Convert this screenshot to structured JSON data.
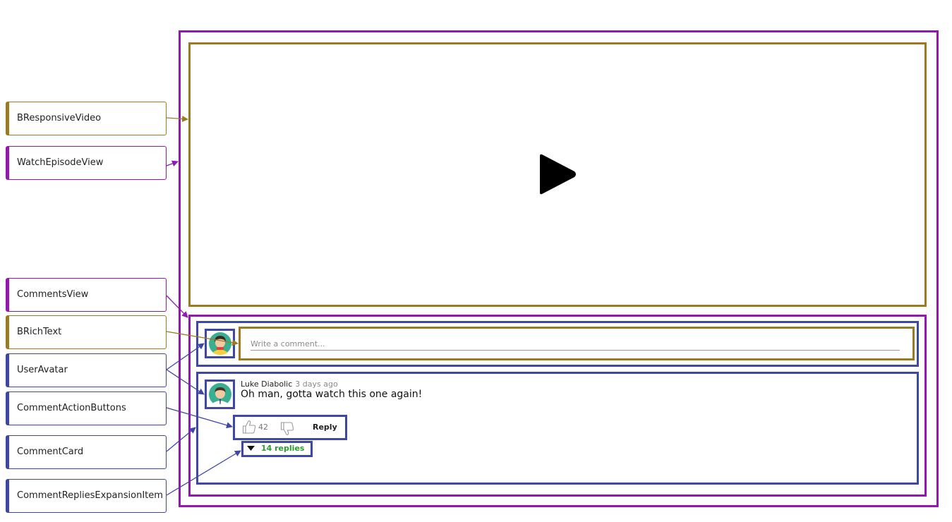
{
  "labels": {
    "responsive_video": "BResponsiveVideo",
    "watch_episode_view": "WatchEpisodeView",
    "comments_view": "CommentsView",
    "rich_text": "BRichText",
    "user_avatar": "UserAvatar",
    "comment_action_buttons": "CommentActionButtons",
    "comment_card": "CommentCard",
    "comment_replies_expansion_item": "CommentRepliesExpansionItem"
  },
  "comment_input": {
    "placeholder": "Write a comment..."
  },
  "comment": {
    "author": "Luke Diabolic",
    "time": "3 days ago",
    "text": "Oh man, gotta watch this one again!",
    "likes": "42",
    "reply_label": "Reply",
    "replies_label": "14 replies"
  },
  "colors": {
    "gold": "#9a7b22",
    "purple": "#9417b0",
    "blue": "#3e46a6",
    "replies_green": "#2a9d2a"
  },
  "icons": [
    "play-icon",
    "thumbs-up-icon",
    "thumbs-down-icon",
    "caret-down-icon",
    "avatar-icon"
  ]
}
